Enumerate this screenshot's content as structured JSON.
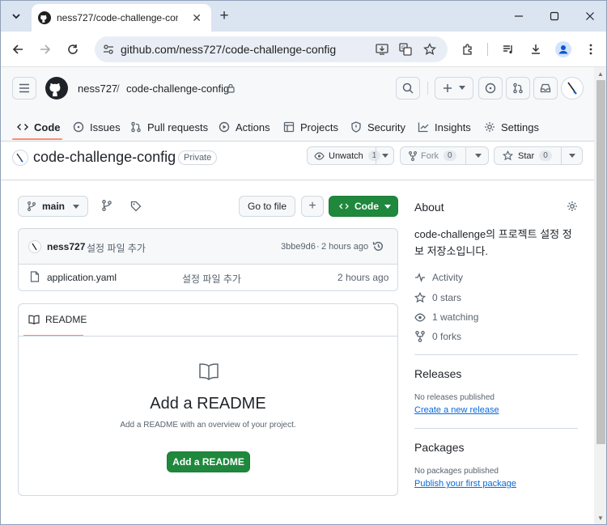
{
  "browser": {
    "tab_title": "ness727/code-challenge-config",
    "url": "github.com/ness727/code-challenge-config"
  },
  "header": {
    "owner": "ness727",
    "separator": "/",
    "repo": "code-challenge-config"
  },
  "nav": [
    {
      "label": "Code",
      "icon": "code-icon"
    },
    {
      "label": "Issues",
      "icon": "issue-icon"
    },
    {
      "label": "Pull requests",
      "icon": "pull-request-icon"
    },
    {
      "label": "Actions",
      "icon": "play-icon"
    },
    {
      "label": "Projects",
      "icon": "table-icon"
    },
    {
      "label": "Security",
      "icon": "shield-icon"
    },
    {
      "label": "Insights",
      "icon": "graph-icon"
    },
    {
      "label": "Settings",
      "icon": "gear-icon"
    }
  ],
  "repo": {
    "name": "code-challenge-config",
    "visibility": "Private",
    "unwatch_label": "Unwatch",
    "watch_count": "1",
    "fork_label": "Fork",
    "fork_count": "0",
    "star_label": "Star",
    "star_count": "0"
  },
  "filebar": {
    "branch": "main",
    "go_to_file": "Go to file",
    "add": "+",
    "code_label": "Code"
  },
  "commit": {
    "author": "ness727",
    "message": "설정 파일 추가",
    "hash": "3bbe9d6",
    "dot": "·",
    "time": "2 hours ago"
  },
  "files": [
    {
      "name": "application.yaml",
      "message": "설정 파일 추가",
      "time": "2 hours ago"
    }
  ],
  "readme": {
    "tab_label": "README",
    "heading": "Add a README",
    "subtitle": "Add a README with an overview of your project.",
    "button": "Add a README"
  },
  "about": {
    "title": "About",
    "description": "code-challenge의 프로젝트 설정 정보 저장소입니다.",
    "activity": "Activity",
    "stars": "0 stars",
    "watching": "1 watching",
    "forks": "0 forks"
  },
  "releases": {
    "title": "Releases",
    "empty": "No releases published",
    "link": "Create a new release"
  },
  "packages": {
    "title": "Packages",
    "empty": "No packages published",
    "link": "Publish your first package"
  },
  "colors": {
    "green": "#1f883d",
    "link": "#0969da",
    "tab_underline": "#fd8c73"
  }
}
